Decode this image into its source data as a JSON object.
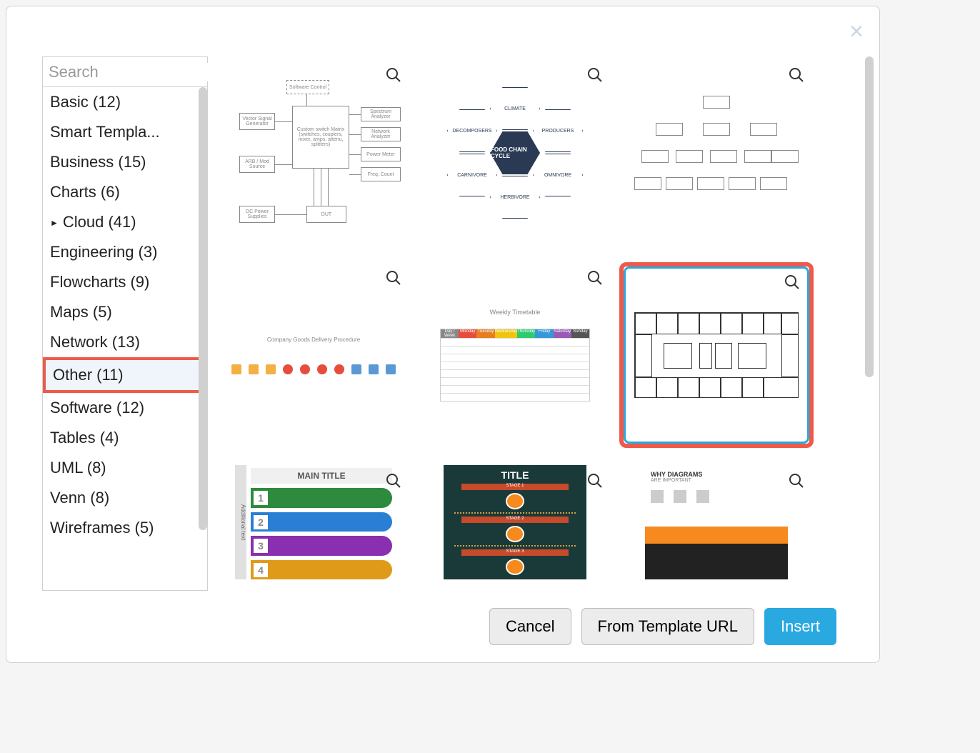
{
  "close_label": "×",
  "search": {
    "placeholder": "Search"
  },
  "categories": [
    {
      "label": "Basic (12)"
    },
    {
      "label": "Smart Templa..."
    },
    {
      "label": "Business (15)"
    },
    {
      "label": "Charts (6)"
    },
    {
      "label": "Cloud (41)",
      "expandable": true
    },
    {
      "label": "Engineering (3)"
    },
    {
      "label": "Flowcharts (9)"
    },
    {
      "label": "Maps (5)"
    },
    {
      "label": "Network (13)"
    },
    {
      "label": "Other (11)",
      "selected": true
    },
    {
      "label": "Software (12)"
    },
    {
      "label": "Tables (4)"
    },
    {
      "label": "UML (8)"
    },
    {
      "label": "Venn (8)"
    },
    {
      "label": "Wireframes (5)"
    }
  ],
  "thumbs": {
    "block": {
      "top": "Software Control",
      "main": "Custom switch Matrix (switches, couplers, mixer, amps, attenu, splitters)",
      "left": [
        "Vector Signal Generator",
        "ARB / Mod Source",
        "DC Power Supplies"
      ],
      "right": [
        "Spectrum Analyzer",
        "Network Analyzer",
        "Power Meter",
        "Freq. Count"
      ],
      "dut": "DUT"
    },
    "hex": {
      "center": "FOOD CHAIN CYCLE",
      "cells": [
        "CLIMATE",
        "DECOMPOSERS",
        "PRODUCERS",
        "CARNIVORE",
        "OMNIVORE",
        "HERBIVORE"
      ]
    },
    "flow": {
      "title": "Company Goods Delivery Procedure"
    },
    "table": {
      "title": "Weekly Timetable",
      "headers": [
        "Day / Week",
        "Monday",
        "Tuesday",
        "Wednesday",
        "Thursday",
        "Friday",
        "Saturday",
        "Sunday"
      ],
      "colors": [
        "#888",
        "#e74c3c",
        "#e67e22",
        "#f1c40f",
        "#2ecc71",
        "#3498db",
        "#9b59b6",
        "#555"
      ]
    },
    "info1": {
      "title": "MAIN TITLE",
      "side": "Additional text",
      "bars": [
        {
          "n": "1",
          "color": "#2e8b3d"
        },
        {
          "n": "2",
          "color": "#2a7fd4"
        },
        {
          "n": "3",
          "color": "#8a2fb0"
        },
        {
          "n": "4",
          "color": "#e09a1a"
        }
      ]
    },
    "info2": {
      "title": "TITLE",
      "stages": [
        "STAGE 1",
        "STAGE 2",
        "STAGE 3"
      ]
    },
    "info3": {
      "title": "WHY DIAGRAMS",
      "subtitle": "ARE IMPORTANT"
    }
  },
  "footer": {
    "cancel": "Cancel",
    "from_url": "From Template URL",
    "insert": "Insert"
  }
}
